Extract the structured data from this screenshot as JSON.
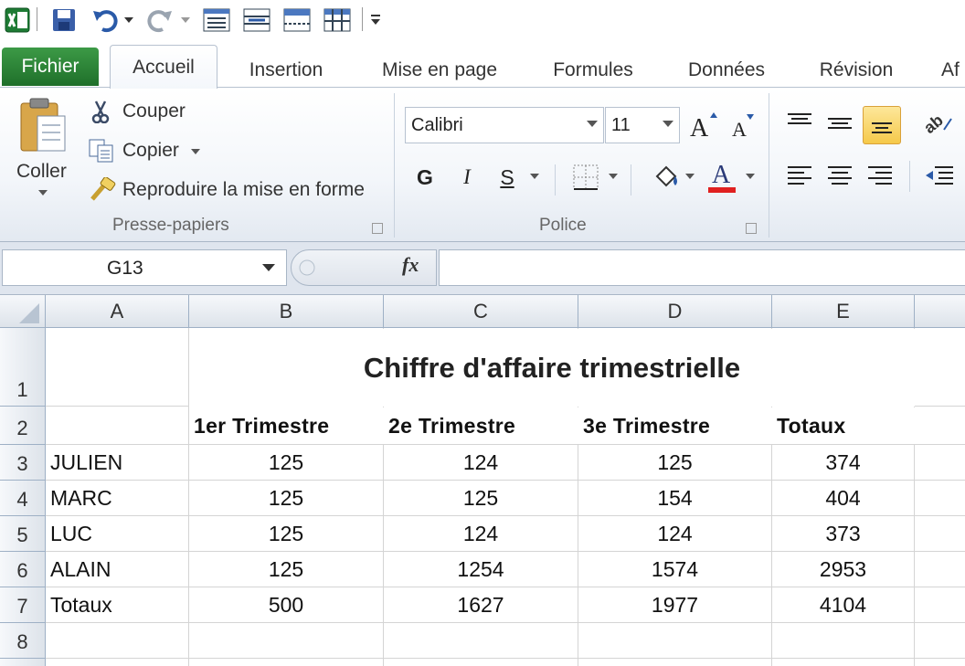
{
  "tabs": {
    "file": "Fichier",
    "items": [
      "Accueil",
      "Insertion",
      "Mise en page",
      "Formules",
      "Données",
      "Révision",
      "Af"
    ]
  },
  "clipboard": {
    "paste": "Coller",
    "cut": "Couper",
    "copy": "Copier",
    "format_painter": "Reproduire la mise en forme",
    "group_label": "Presse-papiers"
  },
  "font": {
    "name": "Calibri",
    "size": "11",
    "bold": "G",
    "italic": "I",
    "underline": "S",
    "group_label": "Police",
    "font_color": "#e02020",
    "highlight_color": "#f5d44a"
  },
  "formula_bar": {
    "name_box": "G13",
    "fx": "fx",
    "value": ""
  },
  "sheet": {
    "columns": [
      "A",
      "B",
      "C",
      "D",
      "E"
    ],
    "rows": [
      "1",
      "2",
      "3",
      "4",
      "5",
      "6",
      "7",
      "8"
    ],
    "title": "Chiffre d'affaire trimestrielle",
    "headers": [
      "1er  Trimestre",
      "2e  Trimestre",
      "3e  Trimestre",
      "Totaux"
    ],
    "data": [
      {
        "name": "JULIEN",
        "q1": "125",
        "q2": "124",
        "q3": "125",
        "total": "374"
      },
      {
        "name": "MARC",
        "q1": "125",
        "q2": "125",
        "q3": "154",
        "total": "404"
      },
      {
        "name": "LUC",
        "q1": "125",
        "q2": "124",
        "q3": "124",
        "total": "373"
      },
      {
        "name": "ALAIN",
        "q1": "125",
        "q2": "1254",
        "q3": "1574",
        "total": "2953"
      },
      {
        "name": "Totaux",
        "q1": "500",
        "q2": "1627",
        "q3": "1977",
        "total": "4104"
      }
    ]
  }
}
